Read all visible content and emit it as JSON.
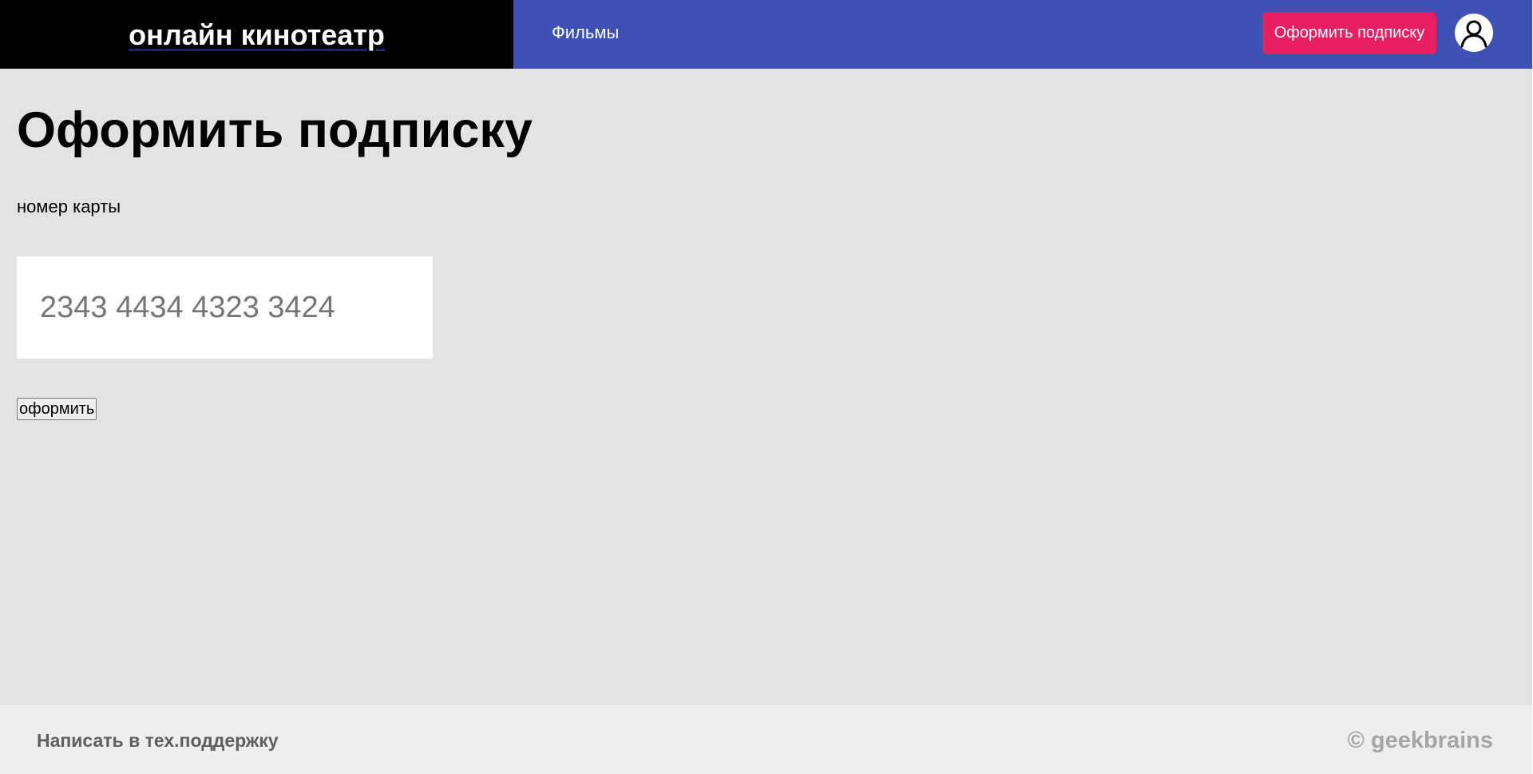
{
  "header": {
    "logo_text": "онлайн кинотеатр",
    "nav_films": "Фильмы",
    "subscribe_button": "Оформить подписку",
    "avatar_icon": "user-avatar-icon"
  },
  "main": {
    "title": "Оформить подписку",
    "card_label": "номер карты",
    "card_placeholder": "2343 4434 4323 3424",
    "card_value": "",
    "submit_button": "оформить"
  },
  "footer": {
    "support_link": "Написать в тех.поддержку",
    "copyright": "© geekbrains"
  },
  "colors": {
    "header_bg": "#3f51b5",
    "logo_bg": "#000000",
    "accent": "#e91e63",
    "main_bg": "#e3e3e3",
    "footer_bg": "#eeeeee"
  }
}
